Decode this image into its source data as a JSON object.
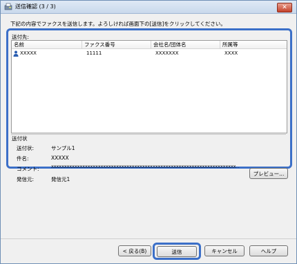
{
  "window": {
    "title": "送信確認 (3 / 3)",
    "close_glyph": "✕"
  },
  "instruction": "下記の内容でファクスを送信します。よろしければ画面下の[送信]をクリックしてください。",
  "destinations": {
    "label": "送付先:",
    "columns": [
      "名前",
      "ファクス番号",
      "会社名/団体名",
      "所属等"
    ],
    "rows": [
      {
        "name": "XXXXX",
        "fax": "11111",
        "company": "XXXXXXX",
        "department": "XXXX"
      }
    ]
  },
  "cover_sheet": {
    "label": "送付状",
    "fields": [
      {
        "label": "送付状:",
        "value": "サンプル1"
      },
      {
        "label": "件名:",
        "value": "XXXXX"
      },
      {
        "label": "コメント:",
        "value": "XXXXXXXXXXXXXXXXXXXXXXXXXXXXXXXXXXXXXXXXXXXXXXXXXXXXXXXXXXXXXXXXXXXXXXX..."
      },
      {
        "label": "発信元:",
        "value": "発信元1"
      }
    ]
  },
  "buttons": {
    "preview": "プレビュー...",
    "back": "< 戻る(B)",
    "send": "送信",
    "cancel": "キャンセル",
    "help": "ヘルプ"
  },
  "colors": {
    "highlight": "#3b6fc8",
    "titlebar": "#c9d9ec"
  }
}
